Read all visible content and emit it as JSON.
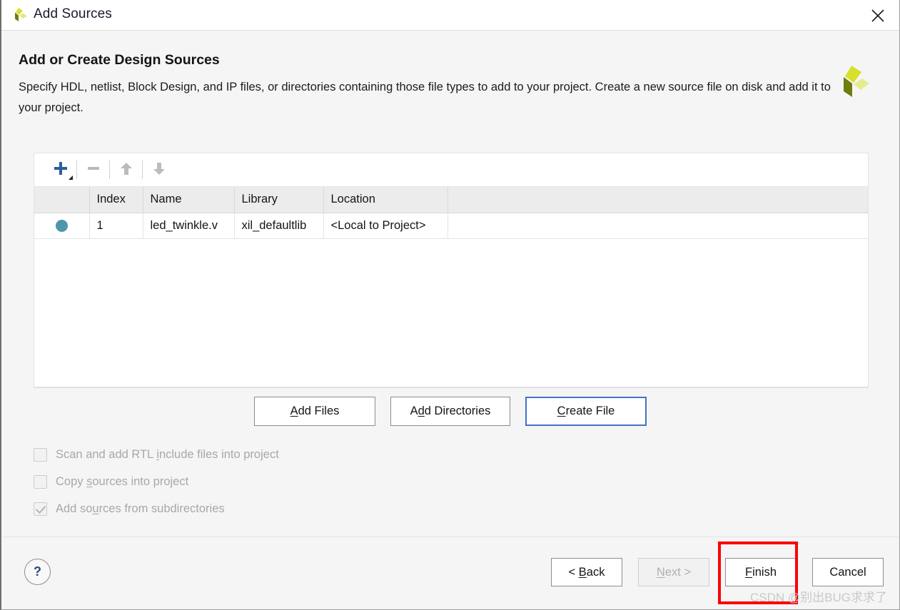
{
  "window": {
    "title": "Add Sources",
    "logo_icon": "xilinx-vivado-logo",
    "close_icon": "close-icon"
  },
  "header": {
    "title": "Add or Create Design Sources",
    "description": "Specify HDL, netlist, Block Design, and IP files, or directories containing those file types to add to your project. Create a new source file on disk and add it to your project.",
    "brand_logo_icon": "xilinx-logo"
  },
  "toolbar": {
    "buttons": [
      {
        "name": "add-button",
        "icon": "plus-icon",
        "enabled": true,
        "has_dropdown": true
      },
      {
        "name": "remove-button",
        "icon": "minus-icon",
        "enabled": false
      },
      {
        "name": "move-up-button",
        "icon": "arrow-up-icon",
        "enabled": false
      },
      {
        "name": "move-down-button",
        "icon": "arrow-down-icon",
        "enabled": false
      }
    ]
  },
  "table": {
    "columns": [
      "",
      "Index",
      "Name",
      "Library",
      "Location"
    ],
    "rows": [
      {
        "status_icon": "verilog-source-dot",
        "index": "1",
        "name": "led_twinkle.v",
        "library": "xil_defaultlib",
        "location": "<Local to Project>"
      }
    ]
  },
  "mid_buttons": [
    {
      "label": "Add Files",
      "mnemonic": "A",
      "focused": false
    },
    {
      "label": "Add Directories",
      "mnemonic": "d",
      "focused": false
    },
    {
      "label": "Create File",
      "mnemonic": "C",
      "focused": true
    }
  ],
  "checkboxes": [
    {
      "label": "Scan and add RTL include files into project",
      "checked": false,
      "enabled": false
    },
    {
      "label": "Copy sources into project",
      "checked": false,
      "enabled": false
    },
    {
      "label": "Add sources from subdirectories",
      "checked": true,
      "enabled": false
    }
  ],
  "footer": {
    "help_label": "?",
    "buttons": [
      {
        "label": "< Back",
        "enabled": true
      },
      {
        "label": "Next >",
        "enabled": false
      },
      {
        "label": "Finish",
        "enabled": true,
        "highlighted": true
      },
      {
        "label": "Cancel",
        "enabled": true
      }
    ]
  },
  "annotation": {
    "highlight_color": "#fb0007",
    "target": "finish-button"
  },
  "watermark": "CSDN @别出BUG求求了"
}
